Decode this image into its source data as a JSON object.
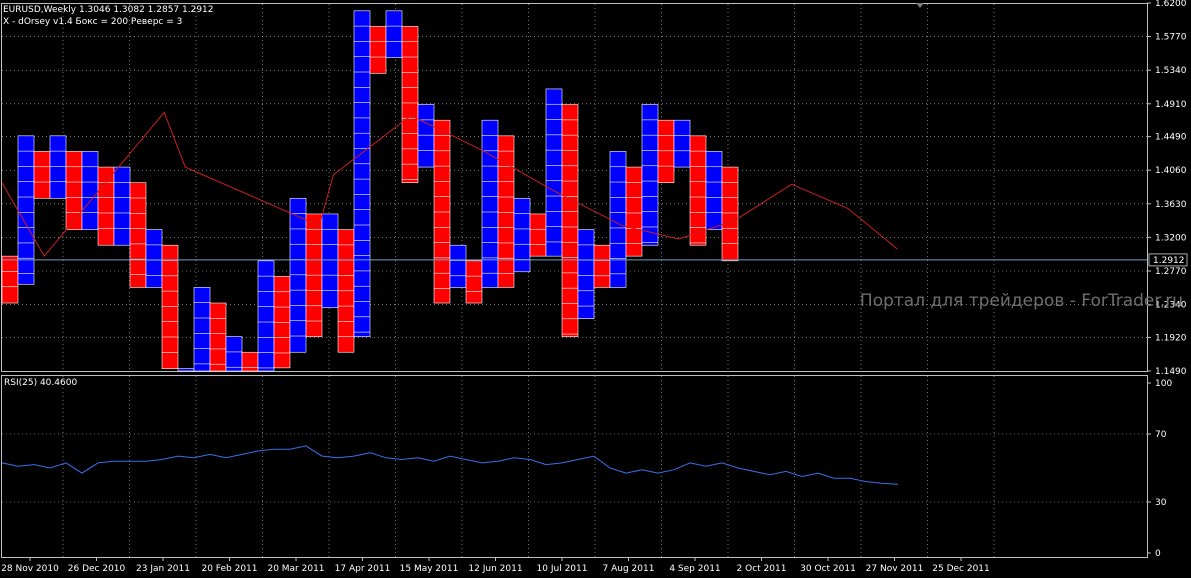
{
  "header": {
    "symbol_line": "EURUSD,Weekly  1.3046 1.3082 1.2857 1.2912",
    "indicator_line": "X - dOrsey v1.4  Бокс = 200  Реверс = 3"
  },
  "watermark": "Портал для трейдеров - ForTrader.ru",
  "colors": {
    "background": "#000000",
    "x_column": "#0000ff",
    "o_column": "#ff0000",
    "grid": "#c0c0c0",
    "overlay_line": "#c81e1e",
    "rsi_line": "#3c6ee6",
    "price_tag": "#6fa0c8"
  },
  "chart_data": [
    {
      "type": "point-and-figure",
      "symbol": "EURUSD",
      "timeframe": "Weekly",
      "ohlc": {
        "open": 1.3046,
        "high": 1.3082,
        "low": 1.2857,
        "close": 1.2912
      },
      "box_size": 200,
      "reversal": 3,
      "current_price": "1.2912",
      "ylim": [
        1.149,
        1.62
      ],
      "y_ticks": [
        "1.6200",
        "1.5770",
        "1.5340",
        "1.4910",
        "1.4490",
        "1.4060",
        "1.3630",
        "1.3200",
        "1.2770",
        "1.2340",
        "1.1920",
        "1.1490"
      ],
      "x_ticks": [
        "28 Nov 2010",
        "26 Dec 2010",
        "23 Jan 2011",
        "20 Feb 2011",
        "20 Mar 2011",
        "17 Apr 2011",
        "15 May 2011",
        "12 Jun 2011",
        "10 Jul 2011",
        "7 Aug 2011",
        "4 Sep 2011",
        "2 Oct 2011",
        "30 Oct 2011",
        "27 Nov 2011",
        "25 Dec 2011"
      ],
      "columns": [
        {
          "type": "O",
          "high": 1.296,
          "low": 1.236
        },
        {
          "type": "X",
          "high": 1.45,
          "low": 1.26
        },
        {
          "type": "O",
          "high": 1.43,
          "low": 1.37
        },
        {
          "type": "X",
          "high": 1.45,
          "low": 1.37
        },
        {
          "type": "O",
          "high": 1.43,
          "low": 1.33
        },
        {
          "type": "X",
          "high": 1.43,
          "low": 1.33
        },
        {
          "type": "O",
          "high": 1.41,
          "low": 1.31
        },
        {
          "type": "X",
          "high": 1.41,
          "low": 1.31
        },
        {
          "type": "O",
          "high": 1.39,
          "low": 1.256
        },
        {
          "type": "X",
          "high": 1.33,
          "low": 1.256
        },
        {
          "type": "O",
          "high": 1.31,
          "low": 1.152
        },
        {
          "type": "X",
          "high": 1.152,
          "low": 1.149
        },
        {
          "type": "X",
          "high": 1.256,
          "low": 1.149
        },
        {
          "type": "O",
          "high": 1.236,
          "low": 1.149
        },
        {
          "type": "X",
          "high": 1.193,
          "low": 1.149
        },
        {
          "type": "O",
          "high": 1.173,
          "low": 1.149
        },
        {
          "type": "X",
          "high": 1.29,
          "low": 1.149
        },
        {
          "type": "O",
          "high": 1.27,
          "low": 1.153
        },
        {
          "type": "X",
          "high": 1.37,
          "low": 1.173
        },
        {
          "type": "O",
          "high": 1.35,
          "low": 1.193
        },
        {
          "type": "X",
          "high": 1.35,
          "low": 1.23
        },
        {
          "type": "O",
          "high": 1.33,
          "low": 1.173
        },
        {
          "type": "X",
          "high": 1.61,
          "low": 1.193
        },
        {
          "type": "O",
          "high": 1.59,
          "low": 1.53
        },
        {
          "type": "X",
          "high": 1.61,
          "low": 1.55
        },
        {
          "type": "O",
          "high": 1.59,
          "low": 1.39
        },
        {
          "type": "X",
          "high": 1.49,
          "low": 1.41
        },
        {
          "type": "O",
          "high": 1.47,
          "low": 1.236
        },
        {
          "type": "X",
          "high": 1.31,
          "low": 1.256
        },
        {
          "type": "O",
          "high": 1.29,
          "low": 1.236
        },
        {
          "type": "X",
          "high": 1.47,
          "low": 1.256
        },
        {
          "type": "O",
          "high": 1.45,
          "low": 1.256
        },
        {
          "type": "X",
          "high": 1.37,
          "low": 1.276
        },
        {
          "type": "O",
          "high": 1.35,
          "low": 1.296
        },
        {
          "type": "X",
          "high": 1.51,
          "low": 1.296
        },
        {
          "type": "O",
          "high": 1.49,
          "low": 1.193
        },
        {
          "type": "X",
          "high": 1.33,
          "low": 1.216
        },
        {
          "type": "O",
          "high": 1.31,
          "low": 1.256
        },
        {
          "type": "X",
          "high": 1.43,
          "low": 1.256
        },
        {
          "type": "O",
          "high": 1.41,
          "low": 1.296
        },
        {
          "type": "X",
          "high": 1.49,
          "low": 1.31
        },
        {
          "type": "O",
          "high": 1.47,
          "low": 1.39
        },
        {
          "type": "X",
          "high": 1.47,
          "low": 1.41
        },
        {
          "type": "O",
          "high": 1.45,
          "low": 1.31
        },
        {
          "type": "X",
          "high": 1.43,
          "low": 1.33
        },
        {
          "type": "O",
          "high": 1.41,
          "low": 1.29
        }
      ],
      "overlay_line": [
        [
          0,
          1.39
        ],
        [
          6,
          1.296
        ],
        [
          23,
          1.48
        ],
        [
          26,
          1.41
        ],
        [
          45,
          1.335
        ],
        [
          47,
          1.4
        ],
        [
          58,
          1.476
        ],
        [
          68,
          1.432
        ],
        [
          78,
          1.381
        ],
        [
          88,
          1.335
        ],
        [
          96,
          1.318
        ],
        [
          104,
          1.342
        ],
        [
          112,
          1.388
        ],
        [
          120,
          1.357
        ],
        [
          127,
          1.305
        ]
      ]
    },
    {
      "type": "line",
      "title": "RSI(25) 40.4600",
      "ylim": [
        0,
        100
      ],
      "y_ticks": [
        "100",
        "70",
        "30",
        "0"
      ],
      "series": [
        {
          "name": "RSI(25)",
          "values": [
            53,
            51,
            52,
            50,
            53,
            47,
            53,
            54,
            54,
            54,
            55,
            57,
            56,
            58,
            56,
            58,
            60,
            61,
            61,
            63,
            57,
            56,
            57,
            59,
            56,
            55,
            56,
            54,
            57,
            55,
            53,
            54,
            56,
            55,
            52,
            53,
            55,
            57,
            50,
            47,
            49,
            47,
            49,
            53,
            51,
            53,
            50,
            48,
            46,
            48,
            45,
            47,
            44,
            44,
            42,
            41,
            40.46
          ]
        }
      ]
    }
  ]
}
